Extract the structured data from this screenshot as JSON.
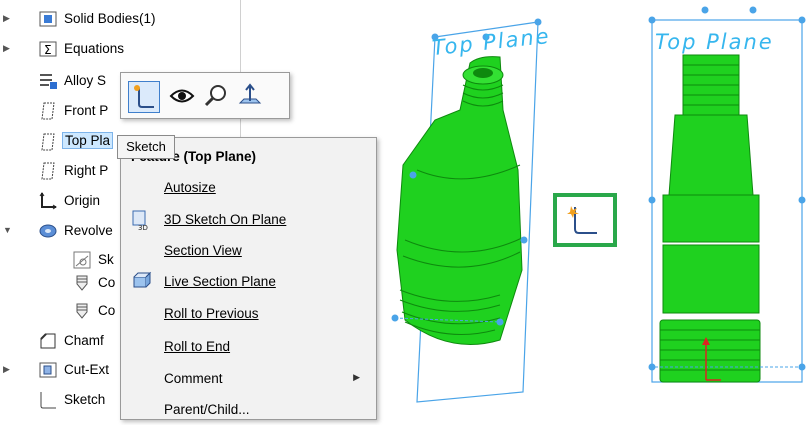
{
  "tree": {
    "items": [
      {
        "label": "Solid Bodies(1)",
        "icon": "solid-bodies-icon"
      },
      {
        "label": "Equations",
        "icon": "equations-icon"
      },
      {
        "label": "Alloy S",
        "icon": "material-icon"
      },
      {
        "label": "Front P",
        "icon": "plane-icon"
      },
      {
        "label": "Top Pla",
        "icon": "plane-icon"
      },
      {
        "label": "Right P",
        "icon": "plane-icon"
      },
      {
        "label": "Origin",
        "icon": "origin-icon"
      },
      {
        "label": "Revolve",
        "icon": "revolve-icon"
      },
      {
        "label": "Sk",
        "icon": "sketch-icon"
      },
      {
        "label": "Co",
        "icon": "cosmetic-thread-icon"
      },
      {
        "label": "Co",
        "icon": "cosmetic-thread-icon"
      },
      {
        "label": "Chamf",
        "icon": "chamfer-icon"
      },
      {
        "label": "Cut-Ext",
        "icon": "cut-extrude-icon"
      },
      {
        "label": "Sketch",
        "icon": "sketch-icon"
      }
    ]
  },
  "tooltip": {
    "text": "Sketch"
  },
  "menu": {
    "title": "Feature (Top Plane)",
    "items": [
      {
        "label": "Autosize",
        "icon": ""
      },
      {
        "label": "3D Sketch On Plane",
        "icon": "3d-sketch-icon"
      },
      {
        "label": "Section View",
        "icon": ""
      },
      {
        "label": "Live Section Plane",
        "icon": "live-section-icon"
      },
      {
        "label": "Roll to Previous",
        "icon": ""
      },
      {
        "label": "Roll to End",
        "icon": ""
      },
      {
        "label": "Comment",
        "icon": "",
        "submenu": true
      },
      {
        "label": "Parent/Child...",
        "icon": ""
      }
    ]
  },
  "viewport": {
    "left_plane_label": "Top Plane",
    "right_plane_label": "Top Plane"
  },
  "colors": {
    "part": "#1fd11f",
    "plane": "#36b6ee",
    "highlight": "#2aa84a"
  }
}
